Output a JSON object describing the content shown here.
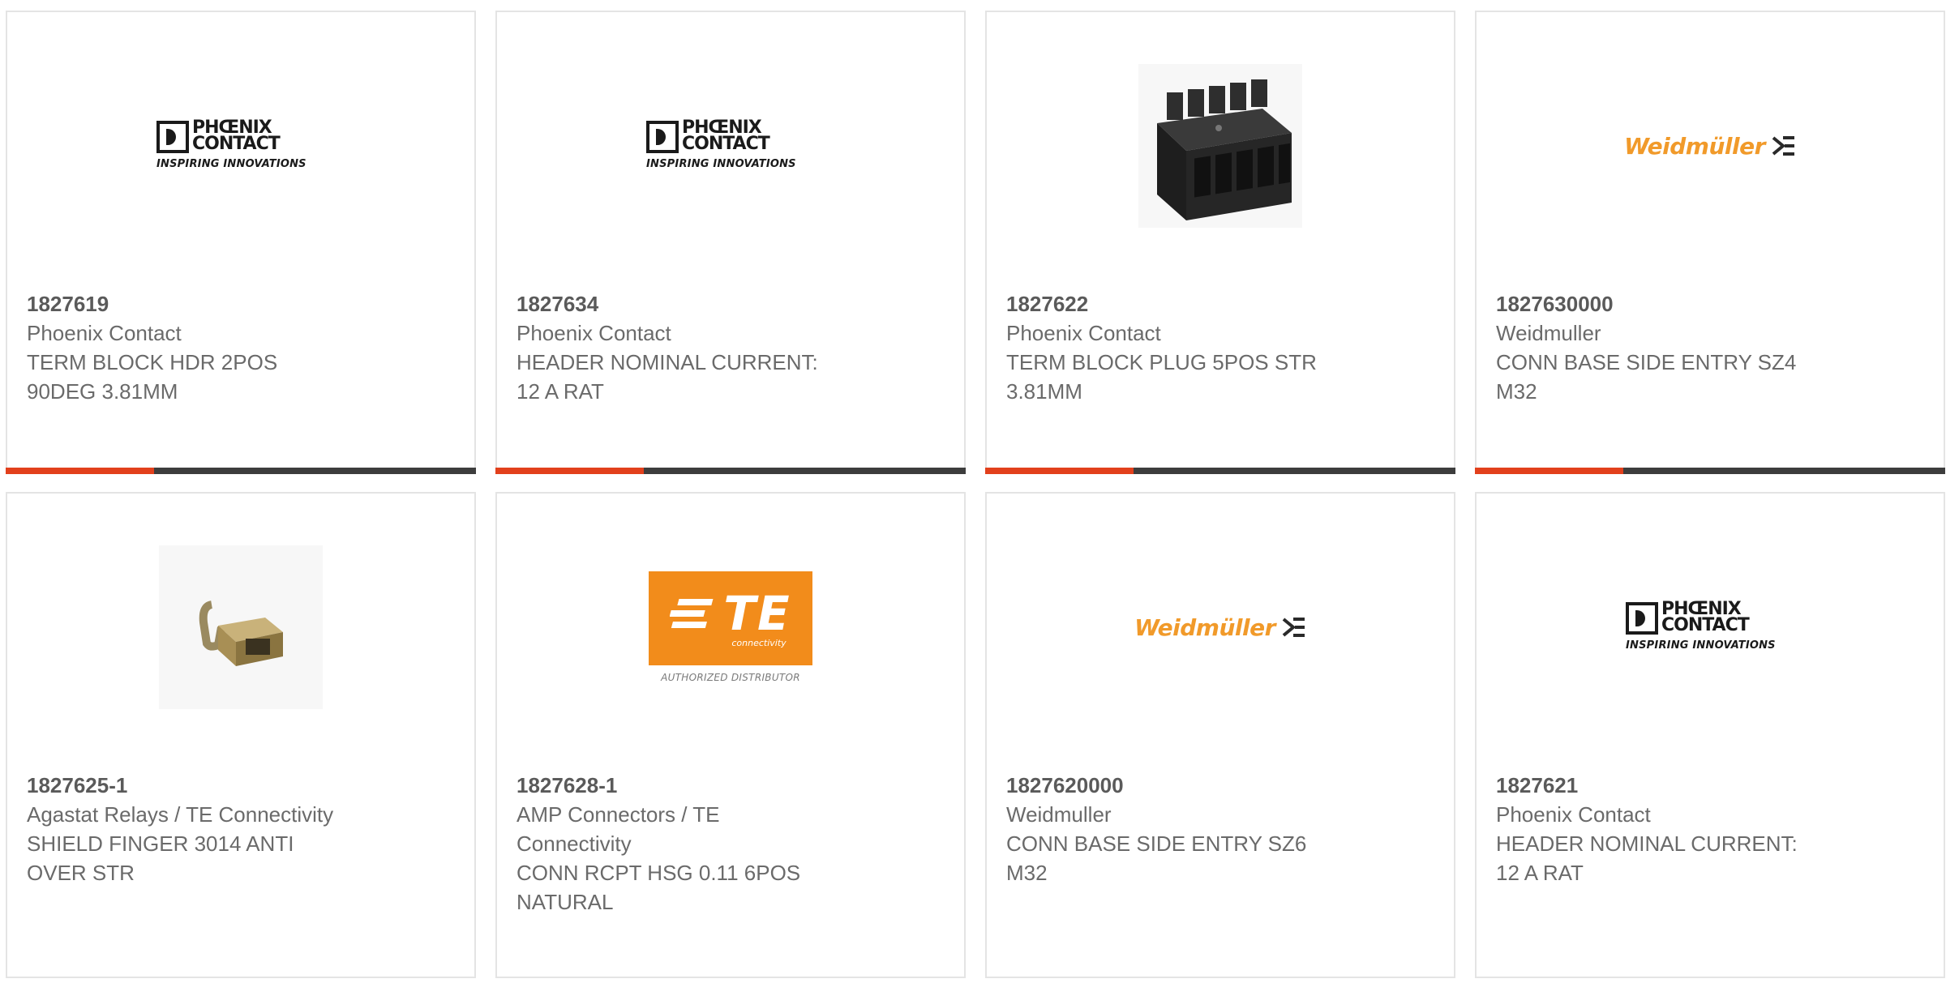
{
  "logos": {
    "phoenix": {
      "word1": "PHŒNIX",
      "word2": "CONTACT",
      "tagline": "INSPIRING INNOVATIONS"
    },
    "weidmuller": {
      "word": "Weidmüller"
    },
    "te": {
      "mark": "TE",
      "sub": "connectivity",
      "authorized": "AUTHORIZED DISTRIBUTOR"
    }
  },
  "products": [
    {
      "part_number": "1827619",
      "manufacturer": "Phoenix Contact",
      "desc1": "TERM BLOCK HDR 2POS",
      "desc2": "90DEG 3.81MM",
      "image": "phoenix-contact-logo"
    },
    {
      "part_number": "1827634",
      "manufacturer": "Phoenix Contact",
      "desc1": "HEADER NOMINAL CURRENT:",
      "desc2": "12 A RAT",
      "image": "phoenix-contact-logo"
    },
    {
      "part_number": "1827622",
      "manufacturer": "Phoenix Contact",
      "desc1": "TERM BLOCK PLUG 5POS STR",
      "desc2": "3.81MM",
      "image": "terminal-block-plug-photo"
    },
    {
      "part_number": "1827630000",
      "manufacturer": "Weidmuller",
      "desc1": "CONN BASE SIDE ENTRY SZ4",
      "desc2": "M32",
      "image": "weidmuller-logo"
    },
    {
      "part_number": "1827625-1",
      "manufacturer": "Agastat Relays / TE Connectivity",
      "desc1": "SHIELD FINGER 3014 ANTI",
      "desc2": "OVER STR",
      "image": "shield-finger-photo"
    },
    {
      "part_number": "1827628-1",
      "manufacturer1": "AMP Connectors / TE",
      "manufacturer2": "Connectivity",
      "desc1": "CONN RCPT HSG 0.11 6POS",
      "desc2": "NATURAL",
      "image": "te-connectivity-logo"
    },
    {
      "part_number": "1827620000",
      "manufacturer": "Weidmuller",
      "desc1": "CONN BASE SIDE ENTRY SZ6",
      "desc2": "M32",
      "image": "weidmuller-logo"
    },
    {
      "part_number": "1827621",
      "manufacturer": "Phoenix Contact",
      "desc1": "HEADER NOMINAL CURRENT:",
      "desc2": "12 A RAT",
      "image": "phoenix-contact-logo"
    }
  ],
  "colors": {
    "accent": "#e2401c",
    "bar_dark": "#3d3d3d",
    "card_border": "#e4e4e4",
    "phoenix_text": "#1a1a1a",
    "weidmuller_orange": "#f19a2a",
    "te_orange": "#f28c1b"
  }
}
